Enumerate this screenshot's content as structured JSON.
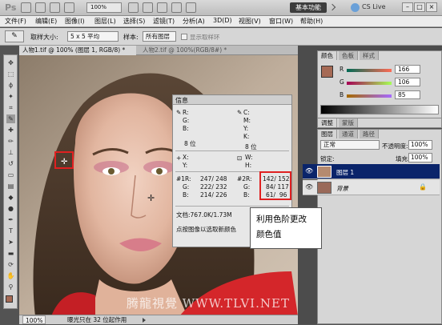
{
  "appbar": {
    "logo": "Ps",
    "zoom": "100%",
    "workspace_button": "基本功能",
    "cslive": "CS Live"
  },
  "menu": [
    "文件(F)",
    "编辑(E)",
    "图像(I)",
    "图层(L)",
    "选择(S)",
    "滤镜(T)",
    "分析(A)",
    "3D(D)",
    "视图(V)",
    "窗口(W)",
    "帮助(H)"
  ],
  "options": {
    "sample_size_label": "取样大小:",
    "sample_size_value": "5 x 5 平均",
    "sample_label": "样本:",
    "sample_value": "所有图层",
    "show_ring_label": "显示取样环"
  },
  "tabs": [
    {
      "label": "人物1.tif @ 100% (图层 1, RGB/8) *"
    },
    {
      "label": "人物2.tif @ 100%(RGB/8#) *"
    }
  ],
  "status": {
    "zoom": "100%",
    "text": "曝光只在 32 位起作用"
  },
  "color_panel": {
    "tabs": [
      "颜色",
      "色板",
      "样式"
    ],
    "R": "166",
    "G": "106",
    "B": "85",
    "swatch_color": "#a66a55"
  },
  "adjust_tabs": [
    "调整",
    "蒙版"
  ],
  "layers_panel": {
    "tabs": [
      "图层",
      "通道",
      "路径"
    ],
    "blend_mode": "正常",
    "opacity_label": "不透明度:",
    "opacity_value": "100%",
    "lock_label": "锁定:",
    "fill_label": "填充:",
    "fill_value": "100%",
    "layers": [
      {
        "name": "图层 1",
        "selected": true
      },
      {
        "name": "背景",
        "selected": false
      }
    ]
  },
  "info_panel": {
    "title": "信息",
    "r": "R:",
    "g": "G:",
    "b": "B:",
    "c": "C:",
    "m": "M:",
    "y": "Y:",
    "k": "K:",
    "bit_left": "8 位",
    "bit_right": "8 位",
    "x": "X:",
    "y_coord": "Y:",
    "w": "W:",
    "h": "H:",
    "s1": {
      "r": "#1R:",
      "g": "G:",
      "b": "B:",
      "r_val": "247/ 248",
      "g_val": "222/ 232",
      "b_val": "214/ 226"
    },
    "s2": {
      "r": "#2R:",
      "g": "G:",
      "b": "B:",
      "r_val": "142/ 152",
      "g_val": "84/ 117",
      "b_val": "61/  96"
    },
    "doc": "文档:767.0K/1.73M",
    "hint": "点按图像以选取新颜色"
  },
  "callout": {
    "line1": "利用色阶更改",
    "line2": "颜色值"
  },
  "watermark": "腾龍視覺 WWW.TLVI.NET"
}
